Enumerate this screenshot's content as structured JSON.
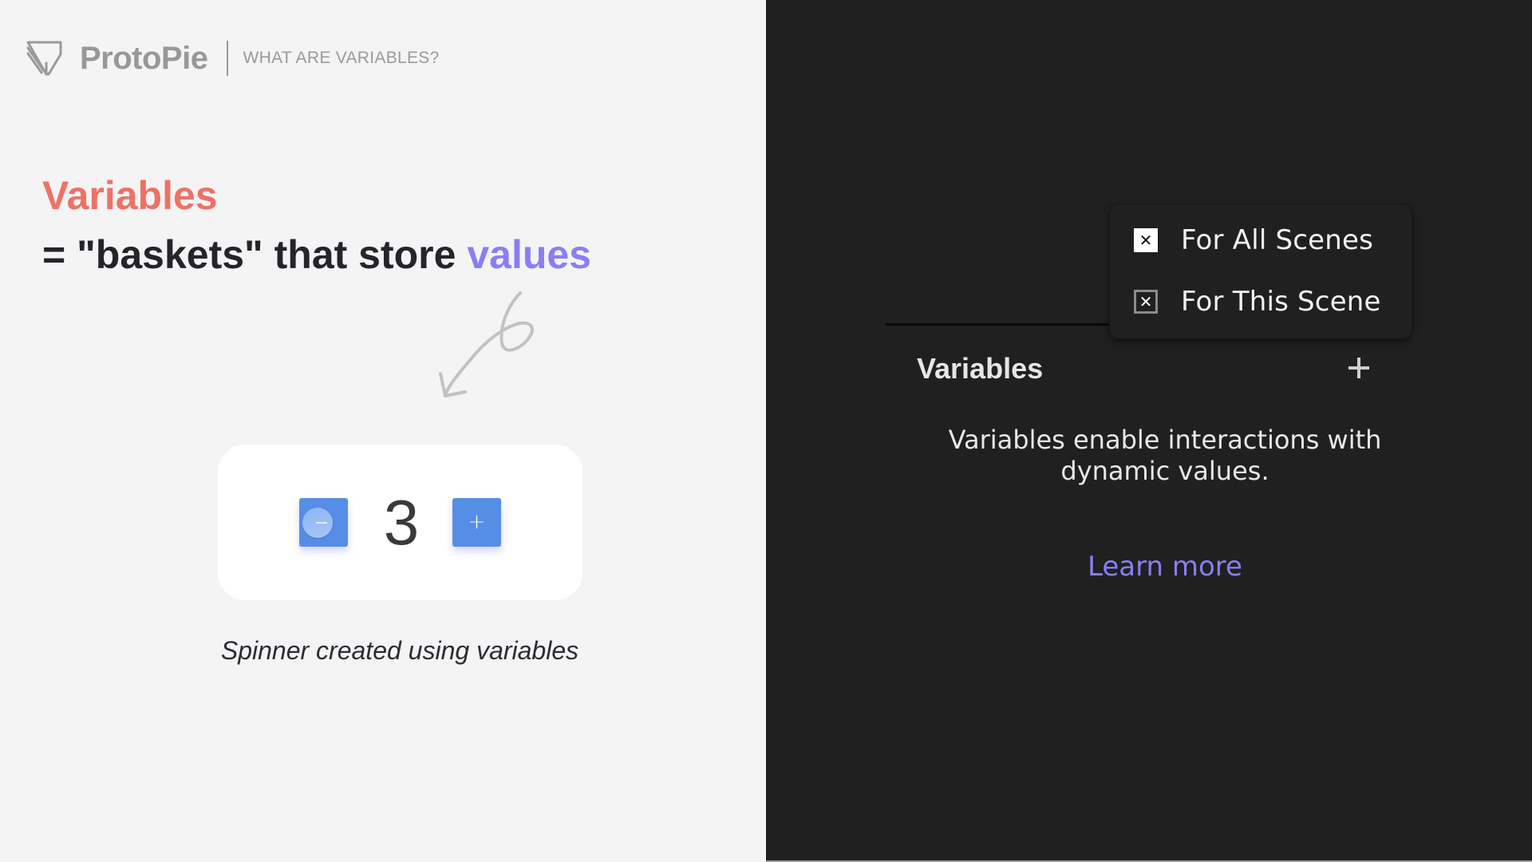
{
  "header": {
    "brand_name": "ProtoPie",
    "subtitle": "WHAT ARE VARIABLES?",
    "logo_icon": "protopie-logo-icon"
  },
  "headline": {
    "title": "Variables",
    "subtitle_prefix": "= \"baskets\" that store ",
    "subtitle_accent": "values"
  },
  "doodle": {
    "icon": "hand-drawn-arrow-icon"
  },
  "spinner": {
    "value": "3",
    "minus_icon": "minus-icon",
    "plus_label": "+"
  },
  "caption": "Spinner created using variables",
  "popup_menu": {
    "items": [
      {
        "label": "For All Scenes",
        "icon": "close-box-filled-icon",
        "glyph": "✕"
      },
      {
        "label": "For This Scene",
        "icon": "close-box-outline-icon",
        "glyph": "✕"
      }
    ]
  },
  "variables_panel": {
    "title": "Variables",
    "add_icon": "plus-icon",
    "empty_description": "Variables enable interactions with dynamic values.",
    "learn_more_label": "Learn more"
  },
  "colors": {
    "accent_red": "#ef7166",
    "accent_purple": "#8a7ef6",
    "spinner_blue": "#568ee6",
    "dark_panel_bg": "#202020",
    "light_bg": "#f4f4f4"
  }
}
